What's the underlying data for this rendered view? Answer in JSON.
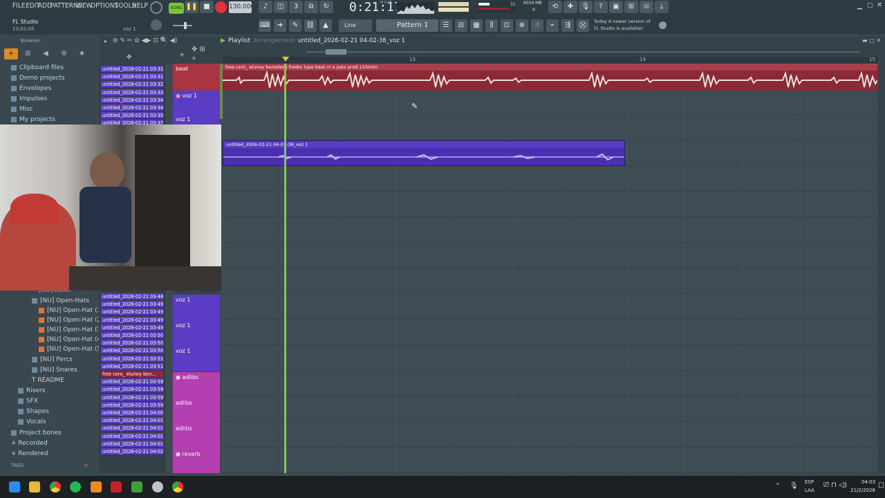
{
  "menu": [
    "FILE",
    "EDIT",
    "ADD",
    "PATTERNS",
    "VIEW",
    "OPTIONS",
    "TOOLS",
    "HELP"
  ],
  "transport": {
    "song_label": "SONG",
    "tempo": "130.000",
    "time": "0:21:17",
    "time_unit": "M:S:CS",
    "cpu": "31",
    "memory": "6034 MB",
    "memory_sub": "0"
  },
  "app": {
    "title": "FL Studio",
    "clock": "13:01:05",
    "current_channel": "voz 1"
  },
  "toolbar": {
    "snap": "Line",
    "pattern": "Pattern 1"
  },
  "news": {
    "line1": "Today  A newer version of",
    "line2": "FL Studio is available!"
  },
  "browser": {
    "title": "Browser",
    "items": [
      "Clipboard files",
      "Demo projects",
      "Envelopes",
      "Impulses",
      "Misc",
      "My projects"
    ],
    "kit_items": [
      "[NU] Kicks",
      "[NU] Open-Hats",
      "[NU] Open-Hat (1)",
      "[NU] Open-Hat (2)",
      "[NU] Open-Hat (3)",
      "[NU] Open-Hat (4)",
      "[NU] Open-Hat (5)",
      "[NU] Percs",
      "[NU] Snares",
      "README",
      "Risers",
      "SFX",
      "Shapes",
      "Vocals",
      "Project bones",
      "Recorded",
      "Rendered"
    ],
    "tags": "TAGS"
  },
  "playlist": {
    "title": "Playlist",
    "subtitle": "Arrangement",
    "project": "untitled_2026-02-21 04-02-38_voz 1",
    "bar13": "13",
    "bar14": "14",
    "bar15": "15"
  },
  "patterns_top": [
    "untitled_2026-02-21 03-31",
    "untitled_2026-02-21 03-31",
    "untitled_2026-02-21 03-32",
    "untitled_2026-02-21 03-33",
    "untitled_2026-02-21 03-34",
    "untitled_2026-02-21 03-34",
    "untitled_2026-02-21 03-35",
    "untitled_2026-02-21 03-37"
  ],
  "patterns_bottom": [
    "untitled_2026-02-21 03-48",
    "untitled_2026-02-21 03-49",
    "untitled_2026-02-21 03-49",
    "untitled_2026-02-21 03-49",
    "untitled_2026-02-21 03-49",
    "untitled_2026-02-21 03-50",
    "untitled_2026-02-21 03-50",
    "untitled_2026-02-21 03-50",
    "untitled_2026-02-21 03-51",
    "untitled_2026-02-21 03-51",
    "free cero_  eluney ben...",
    "untitled_2026-02-21 03-59",
    "untitled_2026-02-21 03-59",
    "untitled_2026-02-21 03-59",
    "untitled_2026-02-21 03-59",
    "untitled_2026-02-21 04-00",
    "untitled_2026-02-21 04-01",
    "untitled_2026-02-21 04-01",
    "untitled_2026-02-21 04-01",
    "untitled_2026-02-21 04-01",
    "untitled_2026-02-21 04-02"
  ],
  "tracks": {
    "beat": "beat",
    "voz1": "voz 1",
    "voz1b": "voz 1",
    "voz1c": "voz 1",
    "voz1d": "voz 1",
    "voz1e": "voz 1",
    "adlibs": "adlibs",
    "adlibs2": "adlibs",
    "adlibs3": "adlibs",
    "reverb": "reverb"
  },
  "clips": {
    "beat": "free cero_   eluney benedetti   fresko type beat ni a palo prod 110mim",
    "voz": "untitled_2026-02-21 04-02-38_voz 1"
  },
  "tray": {
    "lang": "ESP",
    "kb": "LAA",
    "time": "04:03",
    "date": "21/2/2026"
  },
  "colors": {
    "beat": "#8b2a36",
    "voz": "#5b3cc4",
    "adlibs": "#b43fb0",
    "playhead": "#7bd13a"
  }
}
